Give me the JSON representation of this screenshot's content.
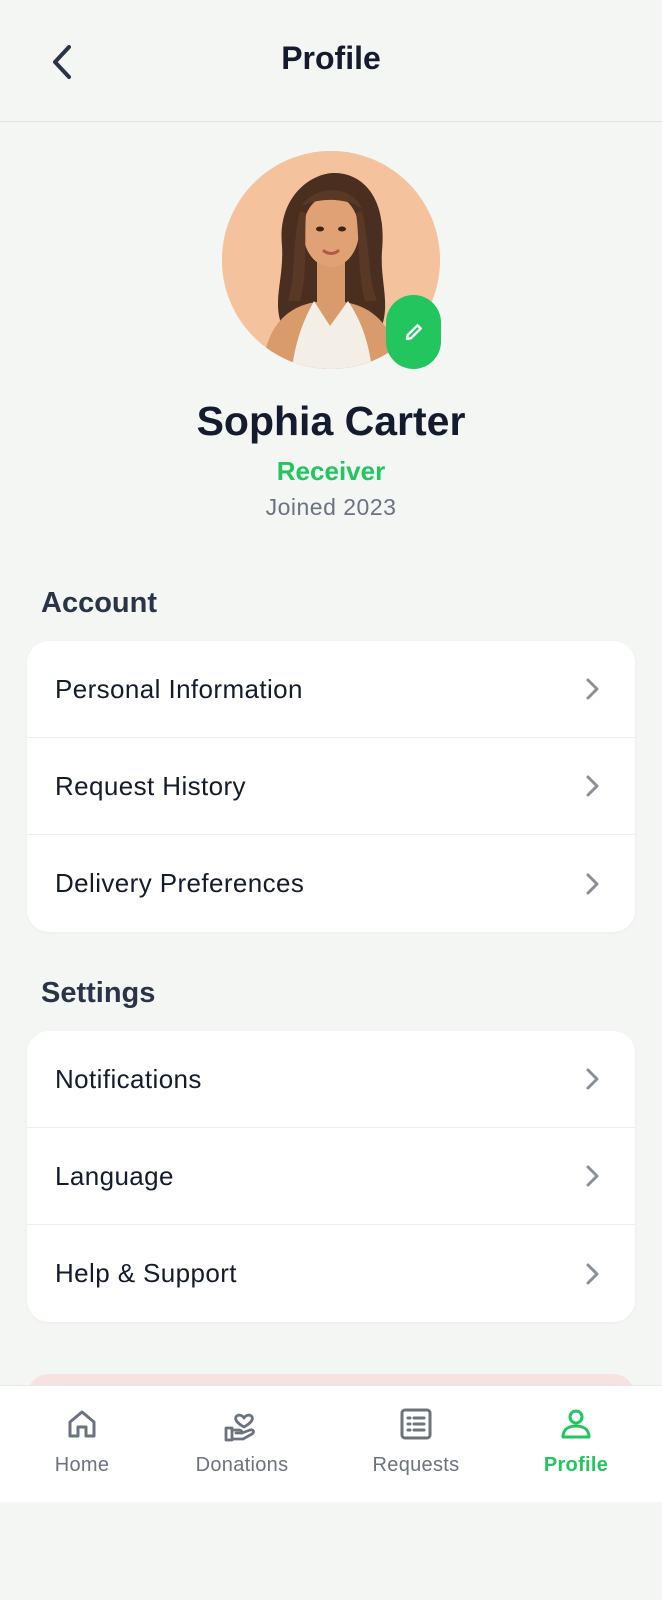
{
  "header": {
    "title": "Profile",
    "back_icon": "chevron-left-icon"
  },
  "profile": {
    "name": "Sophia Carter",
    "role": "Receiver",
    "joined": "Joined 2023",
    "edit_icon": "pencil-icon"
  },
  "account": {
    "title": "Account",
    "items": [
      {
        "label": "Personal Information"
      },
      {
        "label": "Request History"
      },
      {
        "label": "Delivery Preferences"
      }
    ]
  },
  "settings": {
    "title": "Settings",
    "items": [
      {
        "label": "Notifications"
      },
      {
        "label": "Language"
      },
      {
        "label": "Help & Support"
      }
    ]
  },
  "tabs": [
    {
      "label": "Home",
      "icon": "home-icon",
      "active": false
    },
    {
      "label": "Donations",
      "icon": "hand-heart-icon",
      "active": false
    },
    {
      "label": "Requests",
      "icon": "list-icon",
      "active": false
    },
    {
      "label": "Profile",
      "icon": "user-icon",
      "active": true
    }
  ],
  "colors": {
    "accent": "#22C55E",
    "background": "#F4F6F4",
    "text_primary": "#141B2D",
    "text_muted": "#6B7280",
    "logout_tint": "#F6E3E1"
  }
}
